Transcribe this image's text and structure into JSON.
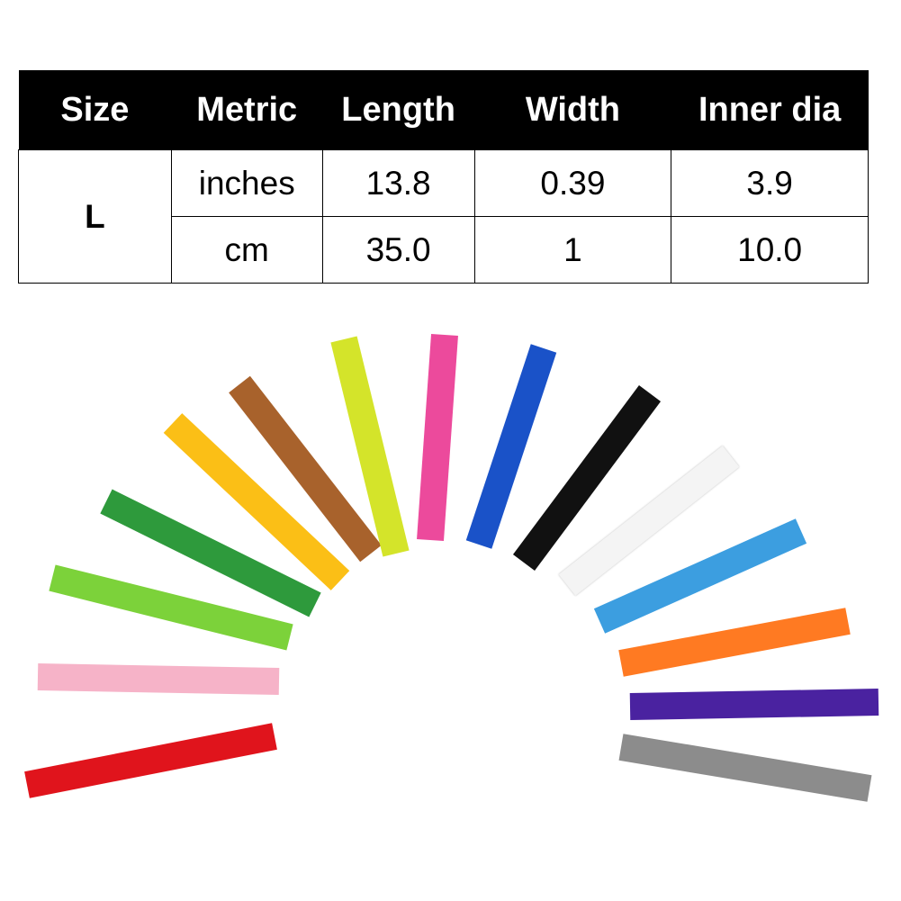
{
  "table": {
    "headers": [
      "Size",
      "Metric",
      "Length",
      "Width",
      "Inner dia"
    ],
    "size": "L",
    "rows": [
      {
        "metric": "inches",
        "length": "13.8",
        "width": "0.39",
        "inner_dia": "3.9"
      },
      {
        "metric": "cm",
        "length": "35.0",
        "width": "1",
        "inner_dia": "10.0"
      }
    ]
  },
  "strap_colors": [
    "#e0141c",
    "#f6b3c8",
    "#7cd23a",
    "#2e9a3c",
    "#fbbf16",
    "#a8622c",
    "#d4e42a",
    "#ec4a9c",
    "#1a52c8",
    "#111111",
    "#f4f4f4",
    "#3c9ee0",
    "#ff7a22",
    "#4a22a0",
    "#8c8c8c"
  ]
}
